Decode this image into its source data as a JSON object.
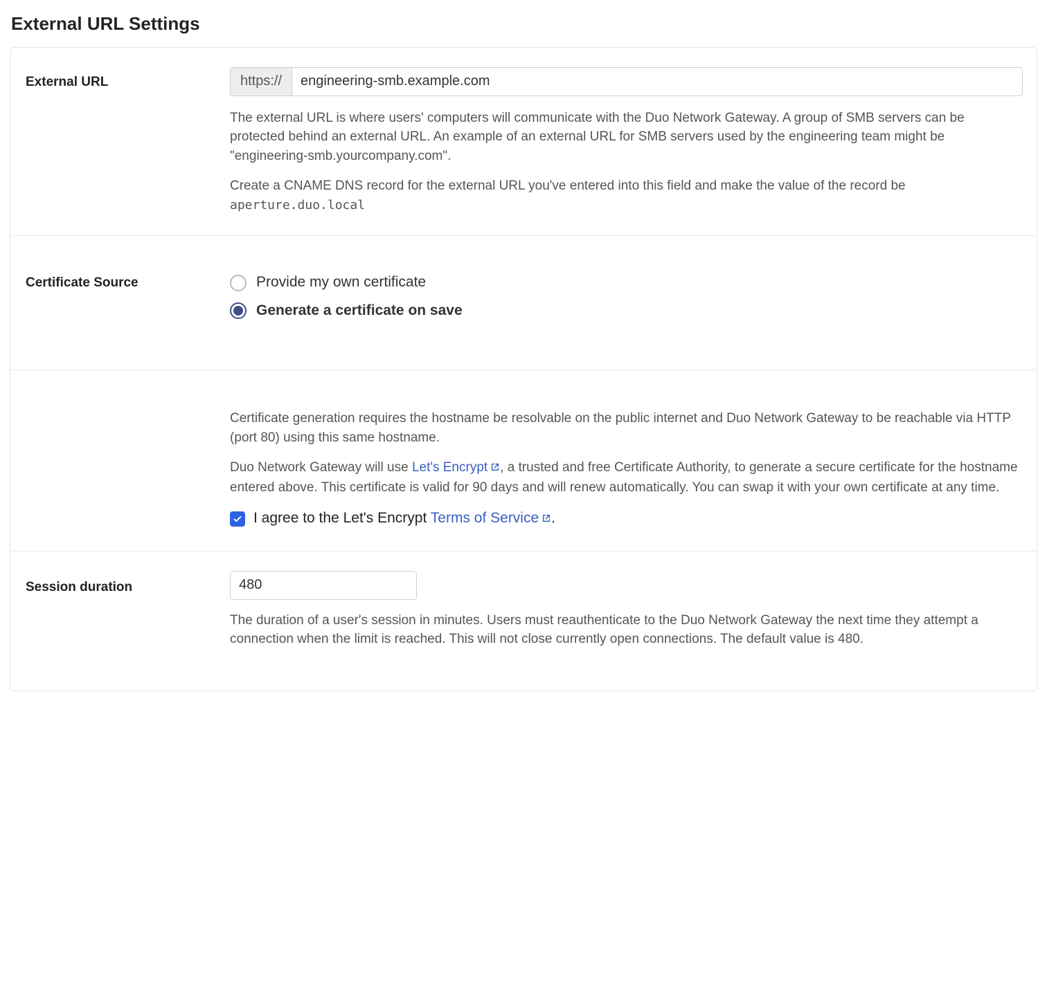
{
  "section_title": "External URL Settings",
  "external_url": {
    "label": "External URL",
    "prefix": "https://",
    "value": "engineering-smb.example.com",
    "help1": "The external URL is where users' computers will communicate with the Duo Network Gateway. A group of SMB servers can be protected behind an external URL. An example of an external URL for SMB servers used by the engineering team might be \"engineering-smb.yourcompany.com\".",
    "help2_pre": "Create a CNAME DNS record for the external URL you've entered into this field and make the value of the record be ",
    "help2_code": "aperture.duo.local"
  },
  "cert_source": {
    "label": "Certificate Source",
    "option_own": "Provide my own certificate",
    "option_generate": "Generate a certificate on save",
    "selected": "generate"
  },
  "cert_details": {
    "para1": "Certificate generation requires the hostname be resolvable on the public internet and Duo Network Gateway to be reachable via HTTP (port 80) using this same hostname.",
    "para2_pre": "Duo Network Gateway will use ",
    "lets_encrypt": "Let's Encrypt",
    "para2_post": ", a trusted and free Certificate Authority, to generate a secure certificate for the hostname entered above. This certificate is valid for 90 days and will renew automatically. You can swap it with your own certificate at any time.",
    "agree_pre": "I agree to the Let's Encrypt ",
    "tos": "Terms of Service",
    "agree_post": ".",
    "agreed": true
  },
  "session": {
    "label": "Session duration",
    "value": "480",
    "help": "The duration of a user's session in minutes. Users must reauthenticate to the Duo Network Gateway the next time they attempt a connection when the limit is reached. This will not close currently open connections. The default value is 480."
  }
}
